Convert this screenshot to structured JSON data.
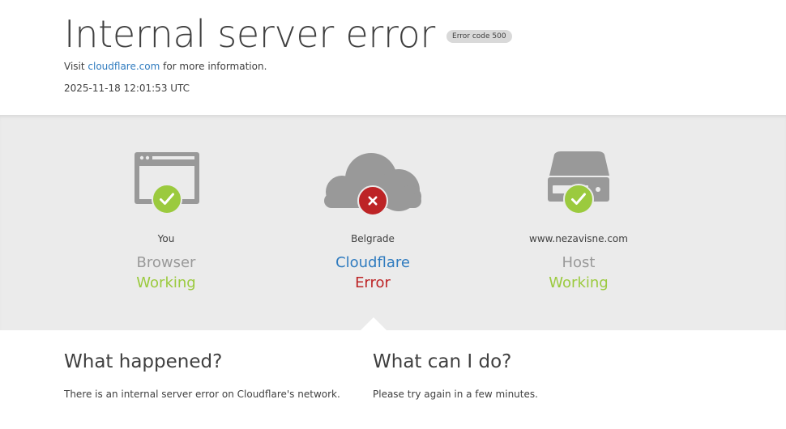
{
  "header": {
    "title": "Internal server error",
    "error_badge": "Error code 500",
    "visit_prefix": "Visit ",
    "visit_link": "cloudflare.com",
    "visit_suffix": " for more information.",
    "timestamp": "2025-11-18 12:01:53 UTC"
  },
  "nodes": [
    {
      "location": "You",
      "label": "Browser",
      "status": "Working",
      "icon": "browser-icon",
      "badge_icon": "check-icon",
      "state": "ok"
    },
    {
      "location": "Belgrade",
      "label": "Cloudflare",
      "status": "Error",
      "icon": "cloud-icon",
      "badge_icon": "x-icon",
      "state": "error"
    },
    {
      "location": "www.nezavisne.com",
      "label": "Host",
      "status": "Working",
      "icon": "server-icon",
      "badge_icon": "check-icon",
      "state": "ok"
    }
  ],
  "info": {
    "what_happened": {
      "heading": "What happened?",
      "text": "There is an internal server error on Cloudflare's network."
    },
    "what_can_i_do": {
      "heading": "What can I do?",
      "text": "Please try again in a few minutes."
    }
  },
  "colors": {
    "ok": "#9bca3e",
    "error": "#bd2426",
    "link": "#2f7bbf",
    "icon_gray": "#999999"
  }
}
